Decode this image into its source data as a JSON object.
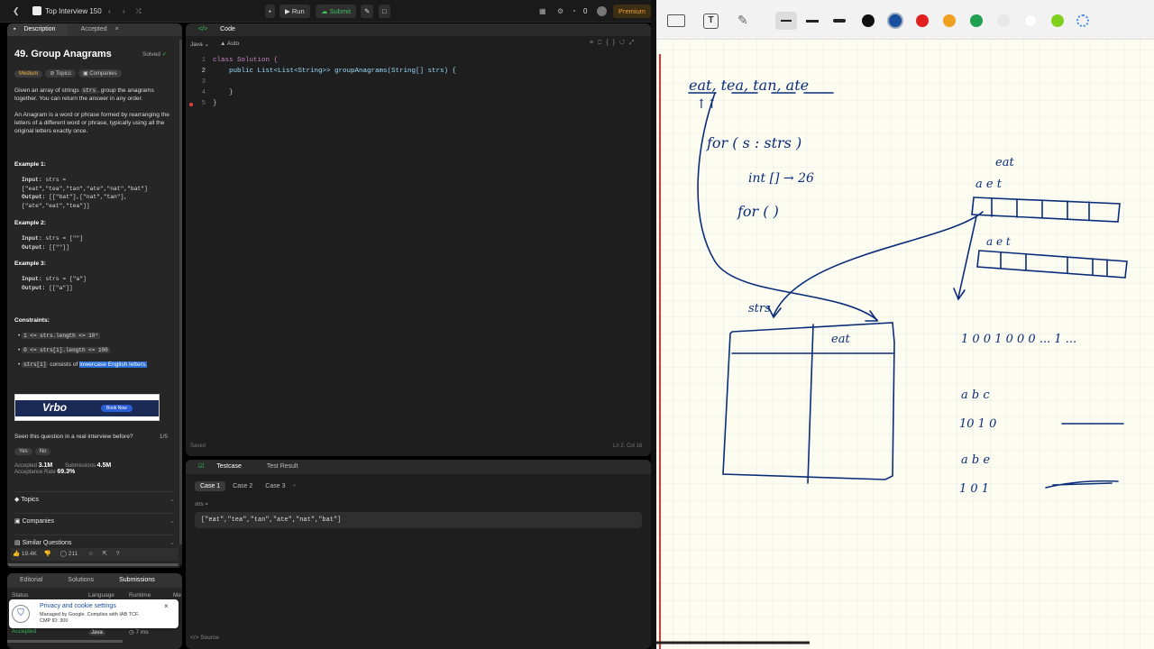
{
  "topbar": {
    "title": "Top Interview 150",
    "run": "Run",
    "submit": "Submit",
    "count": "0",
    "premium": "Premium"
  },
  "desc_tabs": {
    "description": "Description",
    "accepted": "Accepted"
  },
  "problem": {
    "title": "49. Group Anagrams",
    "solved": "Solved",
    "difficulty": "Medium",
    "topics": "Topics",
    "companies": "Companies",
    "p1a": "Given an array of strings ",
    "p1code": "strs",
    "p1b": ", group the anagrams together. You can return the answer in any order.",
    "p2": "An Anagram is a word or phrase formed by rearranging the letters of a different word or phrase, typically using all the original letters exactly once.",
    "ex1_title": "Example 1:",
    "ex1_in_label": "Input:",
    "ex1_in": "strs = [\"eat\",\"tea\",\"tan\",\"ate\",\"nat\",\"bat\"]",
    "ex1_out_label": "Output:",
    "ex1_out": "[[\"bat\"],[\"nat\",\"tan\"],[\"ate\",\"eat\",\"tea\"]]",
    "ex2_title": "Example 2:",
    "ex2_in": "strs = [\"\"]",
    "ex2_out": "[[\"\"]]",
    "ex3_title": "Example 3:",
    "ex3_in": "strs = [\"a\"]",
    "ex3_out": "[[\"a\"]]",
    "constraints_title": "Constraints:",
    "c1": "1 <= strs.length <= 10⁴",
    "c2": "0 <= strs[i].length <= 100",
    "c3code": "strs[i]",
    "c3a": " consists of ",
    "c3hl": "lowercase English letters."
  },
  "ad": {
    "brand": "Vrbo",
    "cta": "Book Now"
  },
  "feedback": {
    "question": "Seen this question in a real interview before?",
    "ratio": "1/5",
    "yes": "Yes",
    "no": "No"
  },
  "stats": {
    "accepted_label": "Accepted",
    "accepted": "3.1M",
    "submissions_label": "Submissions",
    "submissions": "4.5M",
    "rate_label": "Acceptance Rate",
    "rate": "69.3%"
  },
  "sections": {
    "topics": "Topics",
    "companies": "Companies",
    "similar": "Similar Questions"
  },
  "actions": {
    "likes": "19.4K",
    "comments": "211"
  },
  "bottom_tabs": {
    "editorial": "Editorial",
    "solutions": "Solutions",
    "submissions": "Submissions"
  },
  "sub_table": {
    "status": "Status",
    "language": "Language",
    "runtime": "Runtime",
    "me": "Me",
    "row_status": "Accepted",
    "row_lang": "Java",
    "row_runtime": "7 ms"
  },
  "cookie": {
    "title": "Privacy and cookie settings",
    "line1": "Managed by Google. Complies with IAB TCF.",
    "line2": "CMP ID: 300"
  },
  "code_header": {
    "title": "Code",
    "lang": "Java",
    "auto": "Auto",
    "saved": "Saved",
    "cursor": "Ln 2, Col 16"
  },
  "code_lines": [
    "class Solution {",
    "    public List<List<String>> groupAnagrams(String[] strs) {",
    "",
    "    }",
    "}"
  ],
  "testcase": {
    "tab1": "Testcase",
    "tab2": "Test Result",
    "case1": "Case 1",
    "case2": "Case 2",
    "case3": "Case 3",
    "var": "strs =",
    "value": "[\"eat\",\"tea\",\"tan\",\"ate\",\"nat\",\"bat\"]",
    "source": "Source"
  },
  "whiteboard": {
    "tool_text": "T",
    "colors": [
      "#111111",
      "#1a4fa0",
      "#e02020",
      "#f0a020",
      "#20a050",
      "#e8e8e8",
      "#ffffff",
      "#80d020"
    ],
    "words": "eat, tea, tan, ate",
    "loop1": "for (   s :  strs        )",
    "alloc": "int [] → 26",
    "loop2": "for (               )",
    "eat_top": "eat",
    "strs_label": "strs",
    "map_cell": "eat",
    "arr_labels1": "a            e                  t",
    "arr_labels2": "a            e                  t",
    "enc": "1 0 0 1 0 0 0 ... 1 ...",
    "abc1": "a    b    c",
    "abc1v": "10    1    0",
    "abc2": "a    b    e",
    "abc2v": "1    0    1"
  }
}
